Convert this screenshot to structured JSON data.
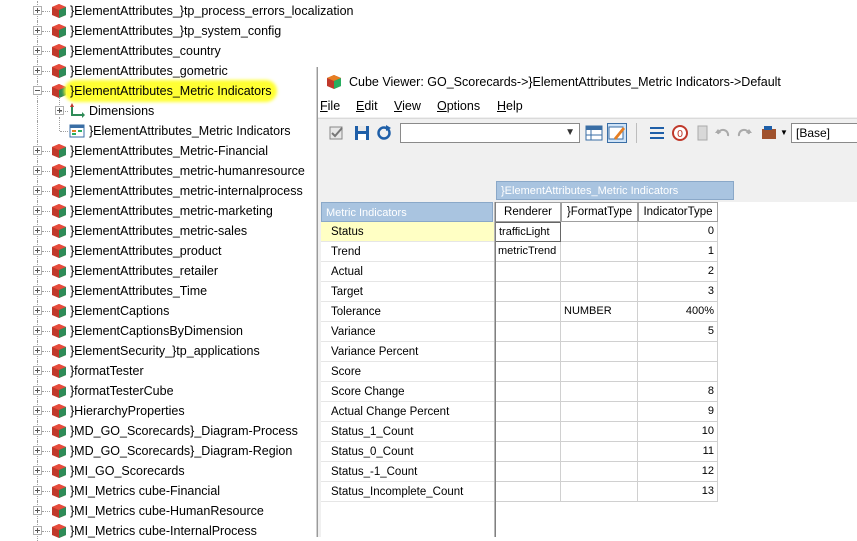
{
  "tree": {
    "items": [
      {
        "label": "}ElementAttributes_}tp_process_errors_localization",
        "expanded": false
      },
      {
        "label": "}ElementAttributes_}tp_system_config",
        "expanded": false
      },
      {
        "label": "}ElementAttributes_country",
        "expanded": false
      },
      {
        "label": "}ElementAttributes_gometric",
        "expanded": false
      },
      {
        "label": "}ElementAttributes_Metric Indicators",
        "expanded": true,
        "highlighted": true
      },
      {
        "label": "Dimensions",
        "child": true,
        "icon": "dimensions-icon"
      },
      {
        "label": "}ElementAttributes_Metric Indicators",
        "child": true,
        "icon": "view-icon"
      },
      {
        "label": "}ElementAttributes_Metric-Financial",
        "expanded": false
      },
      {
        "label": "}ElementAttributes_metric-humanresource",
        "expanded": false
      },
      {
        "label": "}ElementAttributes_metric-internalprocess",
        "expanded": false
      },
      {
        "label": "}ElementAttributes_metric-marketing",
        "expanded": false
      },
      {
        "label": "}ElementAttributes_metric-sales",
        "expanded": false
      },
      {
        "label": "}ElementAttributes_product",
        "expanded": false
      },
      {
        "label": "}ElementAttributes_retailer",
        "expanded": false
      },
      {
        "label": "}ElementAttributes_Time",
        "expanded": false
      },
      {
        "label": "}ElementCaptions",
        "expanded": false
      },
      {
        "label": "}ElementCaptionsByDimension",
        "expanded": false
      },
      {
        "label": "}ElementSecurity_}tp_applications",
        "expanded": false
      },
      {
        "label": "}formatTester",
        "expanded": false
      },
      {
        "label": "}formatTesterCube",
        "expanded": false
      },
      {
        "label": "}HierarchyProperties",
        "expanded": false
      },
      {
        "label": "}MD_GO_Scorecards}_Diagram-Process",
        "expanded": false
      },
      {
        "label": "}MD_GO_Scorecards}_Diagram-Region",
        "expanded": false
      },
      {
        "label": "}MI_GO_Scorecards",
        "expanded": false
      },
      {
        "label": "}MI_Metrics cube-Financial",
        "expanded": false
      },
      {
        "label": "}MI_Metrics cube-HumanResource",
        "expanded": false
      },
      {
        "label": "}MI_Metrics cube-InternalProcess",
        "expanded": false
      }
    ]
  },
  "viewer": {
    "title": "Cube Viewer: GO_Scorecards->}ElementAttributes_Metric Indicators->Default",
    "menu": [
      {
        "label": "File",
        "key": "F",
        "rest": "ile"
      },
      {
        "label": "Edit",
        "key": "E",
        "rest": "dit"
      },
      {
        "label": "View",
        "key": "V",
        "rest": "iew"
      },
      {
        "label": "Options",
        "key": "O",
        "rest": "ptions"
      },
      {
        "label": "Help",
        "key": "H",
        "rest": "elp"
      }
    ],
    "toolbar": {
      "combo_value": "",
      "subset_value": "[Base]"
    },
    "grid": {
      "column_dimension": "}ElementAttributes_Metric Indicators",
      "row_dimension": "Metric Indicators",
      "columns": [
        "Renderer",
        "}FormatType",
        "IndicatorType"
      ],
      "rows": [
        {
          "label": "Status",
          "cells": [
            "trafficLight",
            "",
            "0"
          ]
        },
        {
          "label": "Trend",
          "cells": [
            "metricTrend",
            "",
            "1"
          ]
        },
        {
          "label": "Actual",
          "cells": [
            "",
            "",
            "2"
          ]
        },
        {
          "label": "Target",
          "cells": [
            "",
            "",
            "3"
          ]
        },
        {
          "label": "Tolerance",
          "cells": [
            "",
            "NUMBER",
            "400%"
          ]
        },
        {
          "label": "Variance",
          "cells": [
            "",
            "",
            "5"
          ]
        },
        {
          "label": "Variance Percent",
          "cells": [
            "",
            "",
            ""
          ]
        },
        {
          "label": "Score",
          "cells": [
            "",
            "",
            ""
          ]
        },
        {
          "label": "Score Change",
          "cells": [
            "",
            "",
            "8"
          ]
        },
        {
          "label": "Actual Change Percent",
          "cells": [
            "",
            "",
            "9"
          ]
        },
        {
          "label": "Status_1_Count",
          "cells": [
            "",
            "",
            "10"
          ]
        },
        {
          "label": "Status_0_Count",
          "cells": [
            "",
            "",
            "11"
          ]
        },
        {
          "label": "Status_-1_Count",
          "cells": [
            "",
            "",
            "12"
          ]
        },
        {
          "label": "Status_Incomplete_Count",
          "cells": [
            "",
            "",
            "13"
          ]
        }
      ]
    }
  },
  "colors": {
    "highlight": "#ffff33",
    "dim_header": "#a9c4e0",
    "selected_row": "#ffffc4"
  }
}
